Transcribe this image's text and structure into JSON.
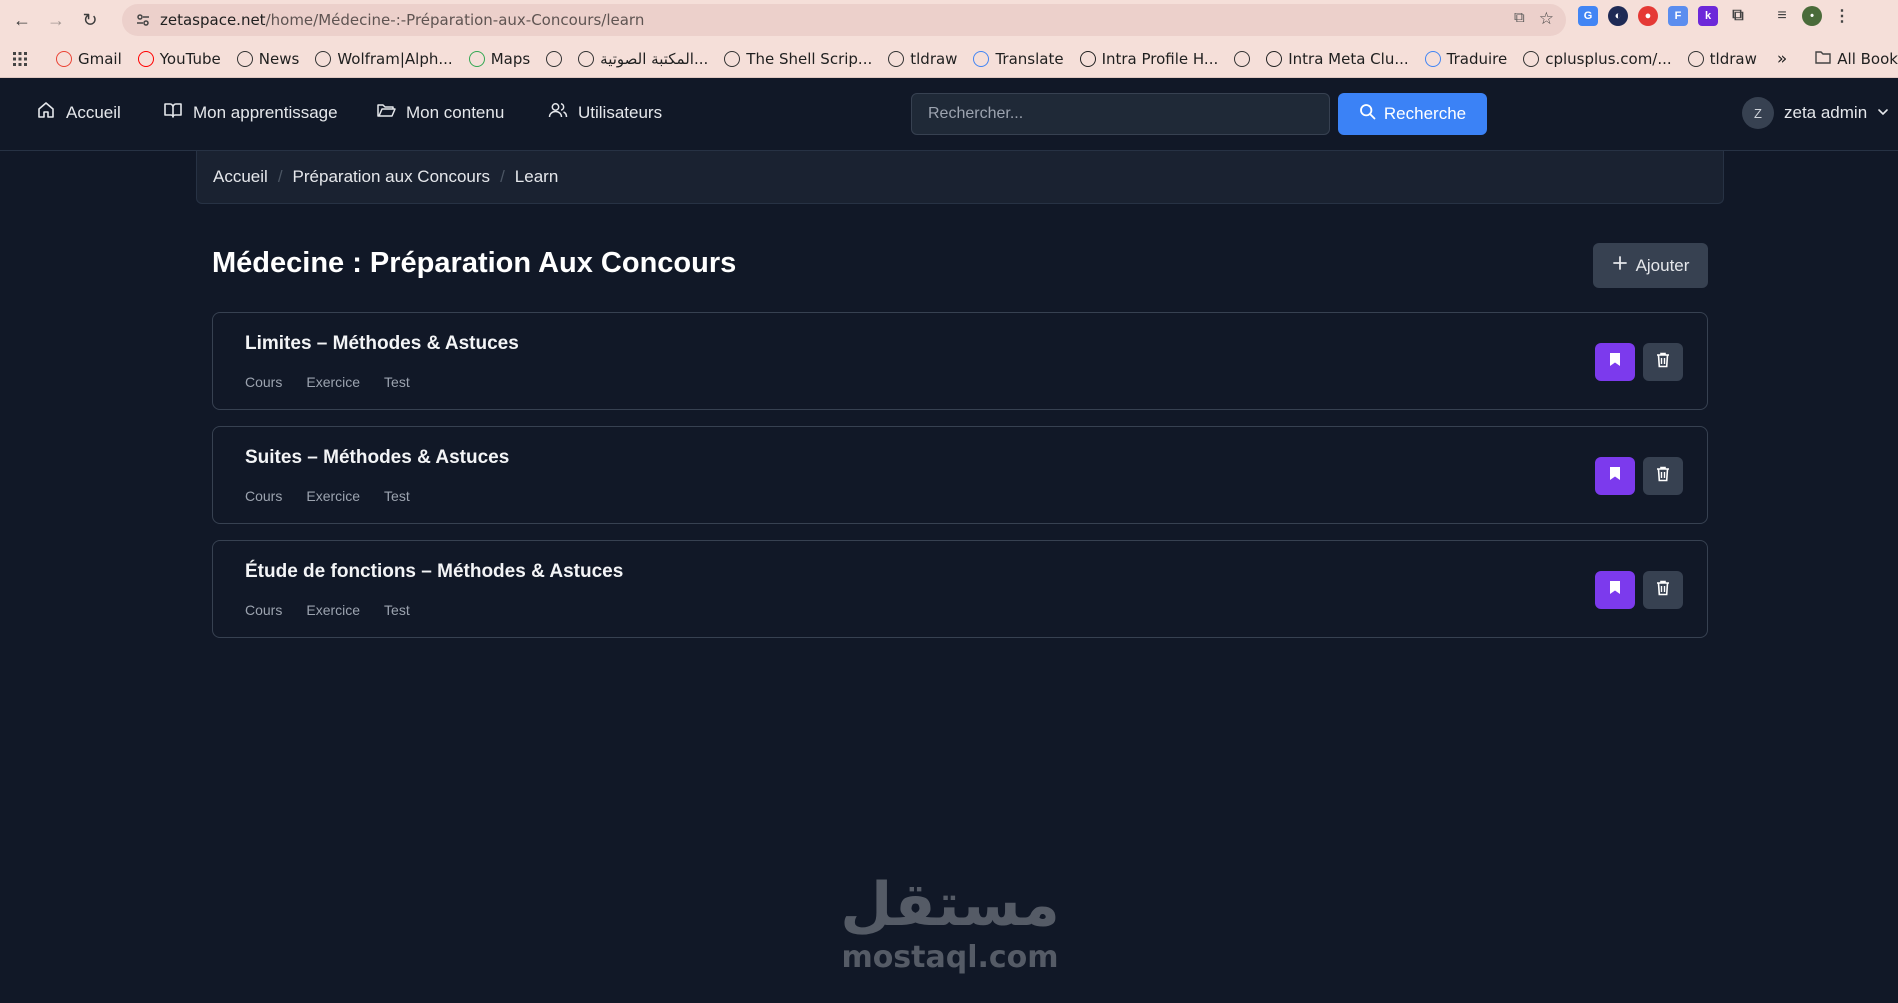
{
  "browser": {
    "url_host": "zetaspace.net",
    "url_path": "/home/Médecine-:-Préparation-aux-Concours/learn",
    "bookmarks": [
      {
        "label": "Gmail",
        "icon": "gmail-icon",
        "color": "#ea4335"
      },
      {
        "label": "YouTube",
        "icon": "youtube-icon",
        "color": "#ff0000"
      },
      {
        "label": "News",
        "icon": "globe-icon",
        "color": "#333333"
      },
      {
        "label": "Wolfram|Alph...",
        "icon": "globe-icon",
        "color": "#333333"
      },
      {
        "label": "Maps",
        "icon": "maps-icon",
        "color": "#34a853"
      },
      {
        "label": "",
        "icon": "globe-icon",
        "color": "#333333"
      },
      {
        "label": "المكتبة الصوتية...",
        "icon": "globe-icon",
        "color": "#333333"
      },
      {
        "label": "The Shell Scrip...",
        "icon": "globe-icon",
        "color": "#333333"
      },
      {
        "label": "tldraw",
        "icon": "globe-icon",
        "color": "#333333"
      },
      {
        "label": "Translate",
        "icon": "translate-icon",
        "color": "#4285f4"
      },
      {
        "label": "Intra Profile H...",
        "icon": "intra-icon",
        "color": "#222222"
      },
      {
        "label": "",
        "icon": "globe-icon",
        "color": "#333333"
      },
      {
        "label": "Intra Meta Clu...",
        "icon": "intra-icon",
        "color": "#222222"
      },
      {
        "label": "Traduire",
        "icon": "translate-icon",
        "color": "#4285f4"
      },
      {
        "label": "cplusplus.com/...",
        "icon": "globe-icon",
        "color": "#333333"
      },
      {
        "label": "tldraw",
        "icon": "tldraw-icon",
        "color": "#333333"
      }
    ],
    "more": "»",
    "all_bookmarks": "All Bookmarks"
  },
  "nav": {
    "home": "Accueil",
    "learning": "Mon apprentissage",
    "content": "Mon contenu",
    "users": "Utilisateurs",
    "search_placeholder": "Rechercher...",
    "search_button": "Recherche",
    "avatar_initial": "Z",
    "user_name": "zeta admin"
  },
  "breadcrumb": [
    "Accueil",
    "Préparation aux Concours",
    "Learn"
  ],
  "page": {
    "title": "Médecine : Préparation Aux Concours",
    "add_button": "Ajouter"
  },
  "items": [
    {
      "title": "Limites – Méthodes & Astuces",
      "links": [
        "Cours",
        "Exercice",
        "Test"
      ]
    },
    {
      "title": "Suites – Méthodes & Astuces",
      "links": [
        "Cours",
        "Exercice",
        "Test"
      ]
    },
    {
      "title": "Étude de fonctions – Méthodes & Astuces",
      "links": [
        "Cours",
        "Exercice",
        "Test"
      ]
    }
  ],
  "watermark": {
    "arabic": "مستقل",
    "latin": "mostaql.com"
  },
  "colors": {
    "accent": "#3b82f6",
    "bookmark": "#7c3aed",
    "background": "#111827"
  }
}
